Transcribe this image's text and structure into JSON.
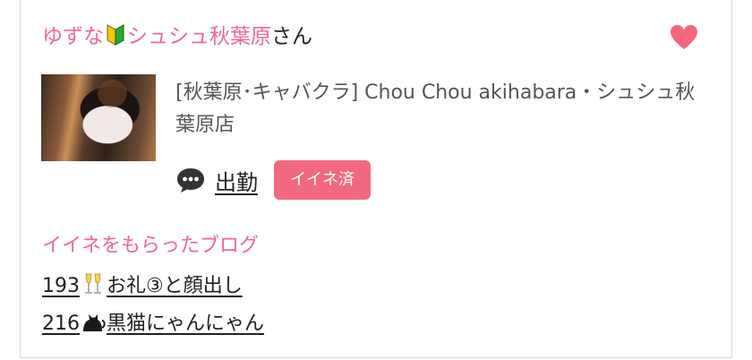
{
  "cast": {
    "name_part1": "ゆずな",
    "name_part2": "シュシュ秋葉原",
    "honorific": "さん",
    "beginner_icon": "beginner-mark-icon"
  },
  "favorite_icon": "heart-icon",
  "shop": {
    "text": "[秋葉原･キャバクラ]  Chou Chou akihabara・シュシュ秋葉原店"
  },
  "work": {
    "icon": "speech-bubble-icon",
    "label": "出勤",
    "iine_button": "イイネ済"
  },
  "blogs": {
    "title": "イイネをもらったブログ",
    "items": [
      {
        "count": "193",
        "icon": "champagne-toast-icon",
        "text": "お礼③と顔出し"
      },
      {
        "count": "216",
        "icon": "black-cat-icon",
        "text": "黒猫にゃんにゃん"
      }
    ]
  },
  "colors": {
    "accent_pink": "#ee6a8f",
    "button_pink": "#f2697f"
  }
}
